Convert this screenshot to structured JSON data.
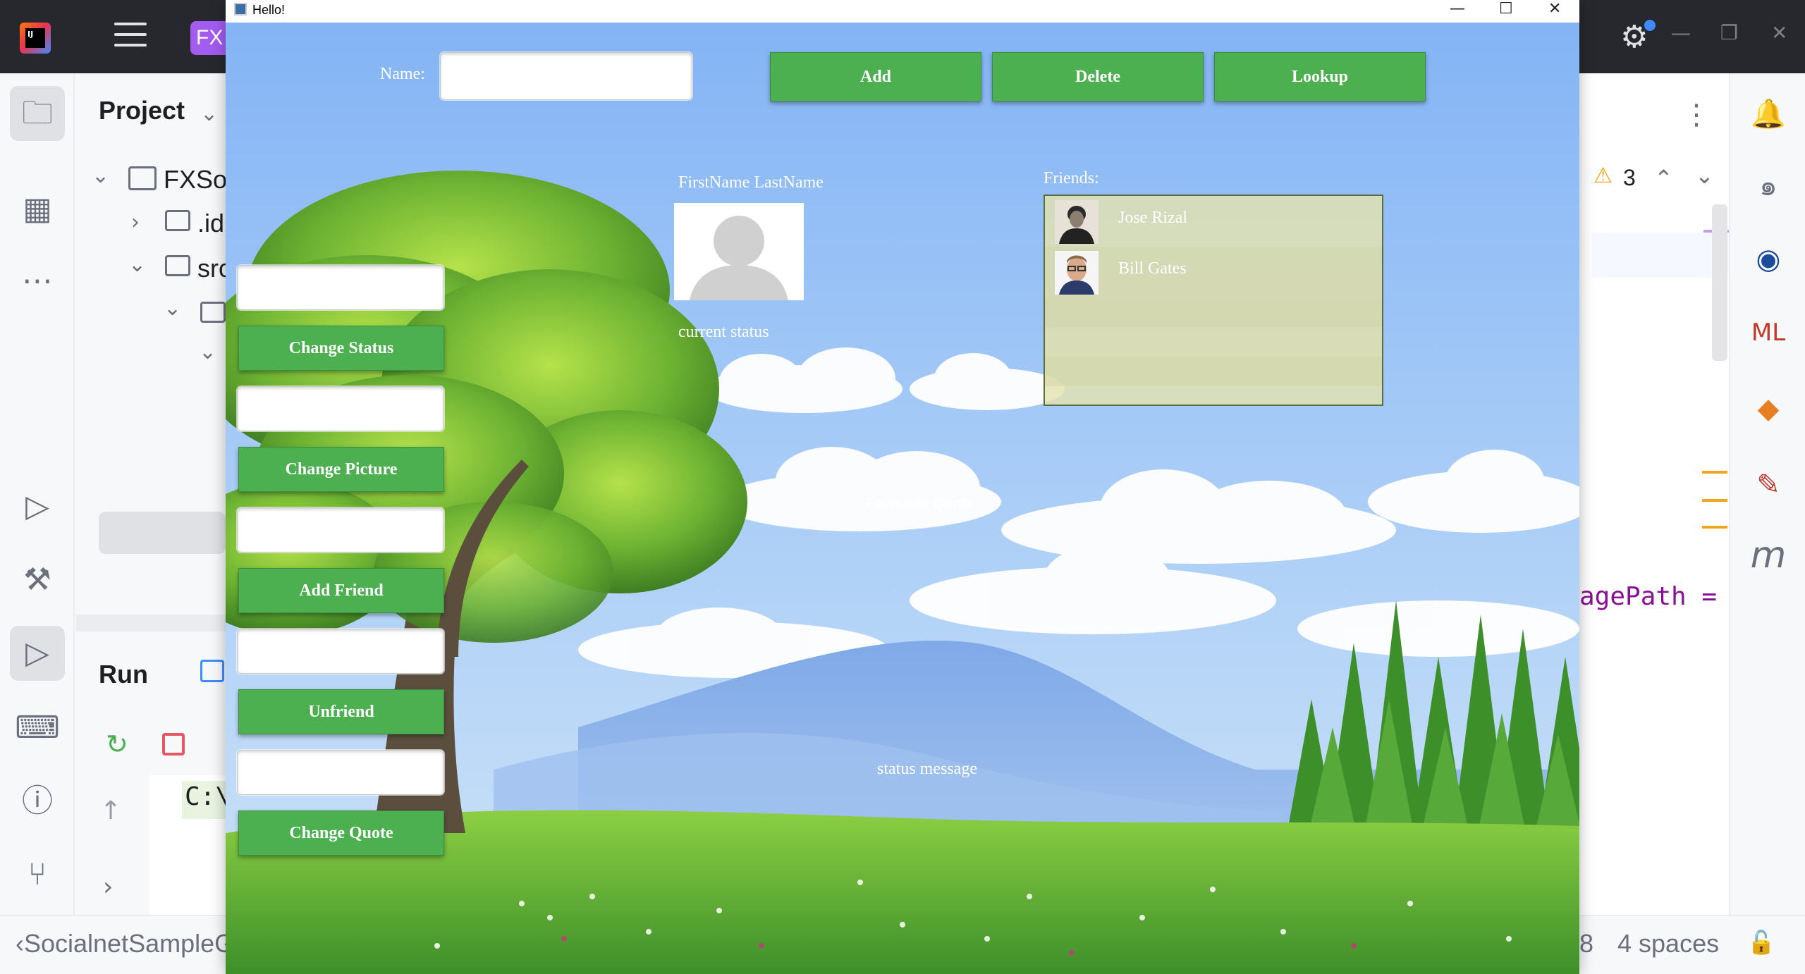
{
  "ide": {
    "logo_text": "IJ",
    "project_badge": "FX",
    "project_panel_title": "Project",
    "tree": [
      {
        "label": "FXSoc"
      },
      {
        "label": ".id"
      },
      {
        "label": "src"
      }
    ],
    "run_title": "Run",
    "console_text": "C:\\",
    "warnings_count": "3",
    "code_fragment": "agePath =",
    "status_path": "‹SocialnetSampleG",
    "status_indent": "4 spaces",
    "status_left_char": "8"
  },
  "app": {
    "window_title": "Hello!",
    "name_label": "Name:",
    "name_value": "",
    "buttons_top": {
      "add": "Add",
      "delete": "Delete",
      "lookup": "Lookup"
    },
    "profile": {
      "name": "FirstName LastName",
      "status": "current status",
      "quote": "Favourite Quote",
      "status_message": "status message"
    },
    "friends_label": "Friends:",
    "friends": [
      {
        "name": "Jose Rizal"
      },
      {
        "name": "Bill Gates"
      }
    ],
    "side_controls": [
      {
        "input_value": "",
        "button": "Change Status"
      },
      {
        "input_value": "",
        "button": "Change Picture"
      },
      {
        "input_value": "",
        "button": "Add Friend"
      },
      {
        "input_value": "",
        "button": "Unfriend"
      },
      {
        "input_value": "",
        "button": "Change Quote"
      }
    ]
  },
  "colors": {
    "button_green": "#4caf50",
    "sky_top": "#84b4f5",
    "ide_topbar": "#27282e",
    "list_bg": "#e3e3b0"
  }
}
